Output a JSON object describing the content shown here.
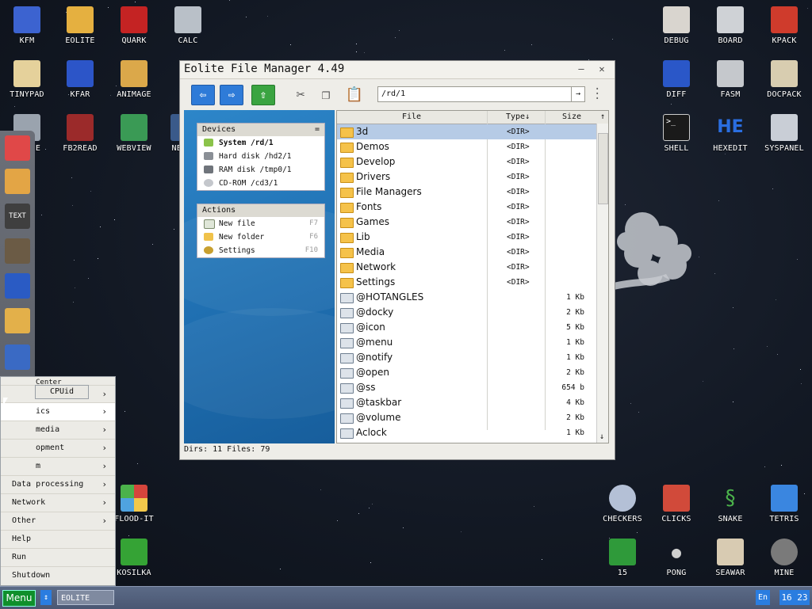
{
  "desktop_icons": [
    {
      "label": "KFM",
      "icon": "floppy-icon",
      "color": "#3c63d0"
    },
    {
      "label": "EOLITE",
      "icon": "folder-icon",
      "color": "#e5b040"
    },
    {
      "label": "QUARK",
      "icon": "book-icon",
      "color": "#c42323"
    },
    {
      "label": "CALC",
      "icon": "calculator-icon",
      "color": "#b9c0c8"
    },
    {
      "label": "TINYPAD",
      "icon": "notepad-icon",
      "color": "#e5d19b"
    },
    {
      "label": "KFAR",
      "icon": "archive-icon",
      "color": "#2c55c8"
    },
    {
      "label": "ANIMAGE",
      "icon": "paint-tools-icon",
      "color": "#dba84a"
    },
    {
      "label": "E",
      "icon": "document-icon",
      "color": "#9aa3ae"
    },
    {
      "label": "FB2READ",
      "icon": "ebook-icon",
      "color": "#9b2a2a"
    },
    {
      "label": "WEBVIEW",
      "icon": "globe-icon",
      "color": "#3a9a55"
    },
    {
      "label": "NE",
      "icon": "network-icon",
      "color": "#3a5a8a"
    },
    {
      "label": "DEBUG",
      "icon": "bug-icon",
      "color": "#d9d5cf"
    },
    {
      "label": "BOARD",
      "icon": "board-icon",
      "color": "#cfd2d6"
    },
    {
      "label": "KPACK",
      "icon": "wrench-icon",
      "color": "#cf3b2c"
    },
    {
      "label": "DIFF",
      "icon": "diff-icon",
      "color": "#2a57c8"
    },
    {
      "label": "FASM",
      "icon": "assembler-icon",
      "color": "#c5c8cc"
    },
    {
      "label": "DOCPACK",
      "icon": "cabinet-icon",
      "color": "#d8cdb0"
    },
    {
      "label": "SHELL",
      "icon": "terminal-icon",
      "color": "#1a1a1a"
    },
    {
      "label": "HEXEDIT",
      "icon": "hex-icon",
      "color": "#2a6ee0"
    },
    {
      "label": "SYSPANEL",
      "icon": "sliders-icon",
      "color": "#c9ced6"
    },
    {
      "label": "FLOOD-IT",
      "icon": "grid-colors-icon",
      "color": "#d5453c"
    },
    {
      "label": "KOSILKA",
      "icon": "lawnmower-icon",
      "color": "#35a335"
    },
    {
      "label": "CHECKERS",
      "icon": "checkers-icon",
      "color": "#b4c0d6"
    },
    {
      "label": "CLICKS",
      "icon": "blocks-icon",
      "color": "#d14a3a"
    },
    {
      "label": "SNAKE",
      "icon": "snake-icon",
      "color": "#4bb24b"
    },
    {
      "label": "TETRIS",
      "icon": "tetris-icon",
      "color": "#3a86e0"
    },
    {
      "label": "15",
      "icon": "fifteen-puzzle-icon",
      "color": "#2f9a3a"
    },
    {
      "label": "PONG",
      "icon": "pong-icon",
      "color": "#cfcfcf"
    },
    {
      "label": "SEAWAR",
      "icon": "seawar-icon",
      "color": "#d8cbb2"
    },
    {
      "label": "MINE",
      "icon": "mine-icon",
      "color": "#7a7a7a"
    }
  ],
  "start_menu": {
    "tooltip": "CPUid",
    "partial_header": "Center",
    "items": [
      {
        "label": "",
        "arrow": "›"
      },
      {
        "label": "ics",
        "arrow": "›"
      },
      {
        "label": "media",
        "arrow": "›"
      },
      {
        "label": "opment",
        "arrow": "›"
      },
      {
        "label": "m",
        "arrow": "›"
      },
      {
        "label": "Data processing",
        "arrow": "›"
      },
      {
        "label": "Network",
        "arrow": "›"
      },
      {
        "label": "Other",
        "arrow": "›"
      },
      {
        "label": "Help",
        "arrow": ""
      },
      {
        "label": "Run",
        "arrow": ""
      },
      {
        "label": "Shutdown",
        "arrow": ""
      }
    ]
  },
  "taskbar": {
    "menu": "Menu",
    "task": "EOLITE",
    "lang": "En",
    "clock": "16 23"
  },
  "window": {
    "title": "Eolite File Manager 4.49",
    "minimize": "–",
    "close": "✕",
    "path": "/rd/1",
    "go": "→",
    "devices": {
      "header": "Devices",
      "menu": "=",
      "items": [
        {
          "label": "System /rd/1",
          "bold": true,
          "color": "#8bc34a"
        },
        {
          "label": "Hard disk /hd2/1",
          "bold": false,
          "color": "#8a8f96"
        },
        {
          "label": "RAM disk /tmp0/1",
          "bold": false,
          "color": "#6f747b"
        },
        {
          "label": "CD-ROM /cd3/1",
          "bold": false,
          "color": "#c4c7cc"
        }
      ]
    },
    "actions": {
      "header": "Actions",
      "items": [
        {
          "label": "New file",
          "key": "F7",
          "color": "#dfe6d8"
        },
        {
          "label": "New folder",
          "key": "F6",
          "color": "#f0c24a"
        },
        {
          "label": "Settings",
          "key": "F10",
          "color": "#c8a030"
        }
      ]
    },
    "columns": {
      "file": "File",
      "type": "Type↓",
      "size": "Size",
      "up": "↑"
    },
    "files": [
      {
        "name": "3d",
        "type": "<DIR>",
        "size": "",
        "kind": "dir",
        "selected": true
      },
      {
        "name": "Demos",
        "type": "<DIR>",
        "size": "",
        "kind": "dir"
      },
      {
        "name": "Develop",
        "type": "<DIR>",
        "size": "",
        "kind": "dir"
      },
      {
        "name": "Drivers",
        "type": "<DIR>",
        "size": "",
        "kind": "dir"
      },
      {
        "name": "File Managers",
        "type": "<DIR>",
        "size": "",
        "kind": "dir"
      },
      {
        "name": "Fonts",
        "type": "<DIR>",
        "size": "",
        "kind": "dir"
      },
      {
        "name": "Games",
        "type": "<DIR>",
        "size": "",
        "kind": "dir"
      },
      {
        "name": "Lib",
        "type": "<DIR>",
        "size": "",
        "kind": "dir"
      },
      {
        "name": "Media",
        "type": "<DIR>",
        "size": "",
        "kind": "dir"
      },
      {
        "name": "Network",
        "type": "<DIR>",
        "size": "",
        "kind": "dir"
      },
      {
        "name": "Settings",
        "type": "<DIR>",
        "size": "",
        "kind": "dir"
      },
      {
        "name": "@HOTANGLES",
        "type": "",
        "size": "1 Kb",
        "kind": "file"
      },
      {
        "name": "@docky",
        "type": "",
        "size": "2 Kb",
        "kind": "file"
      },
      {
        "name": "@icon",
        "type": "",
        "size": "5 Kb",
        "kind": "file"
      },
      {
        "name": "@menu",
        "type": "",
        "size": "1 Kb",
        "kind": "file"
      },
      {
        "name": "@notify",
        "type": "",
        "size": "1 Kb",
        "kind": "file"
      },
      {
        "name": "@open",
        "type": "",
        "size": "2 Kb",
        "kind": "file"
      },
      {
        "name": "@ss",
        "type": "",
        "size": "654 b",
        "kind": "file"
      },
      {
        "name": "@taskbar",
        "type": "",
        "size": "4 Kb",
        "kind": "file"
      },
      {
        "name": "@volume",
        "type": "",
        "size": "2 Kb",
        "kind": "file"
      },
      {
        "name": "Aclock",
        "type": "",
        "size": "1 Kb",
        "kind": "file"
      }
    ],
    "scroll_down": "↓",
    "status": "Dirs: 11   Files: 79"
  },
  "dock_icons": [
    {
      "icon": "irc-icon",
      "color": "#e04848"
    },
    {
      "icon": "package-icon",
      "color": "#e3a545"
    },
    {
      "icon": "text-icon",
      "color": "#3f3f3f"
    },
    {
      "icon": "speaker-icon",
      "color": "#6b5b45"
    },
    {
      "icon": "midi-player-icon",
      "color": "#2a5bc4"
    },
    {
      "icon": "image-viewer-icon",
      "color": "#e3b04a"
    },
    {
      "icon": "hardware-icon",
      "color": "#3a6ac4"
    },
    {
      "icon": "cpu-icon",
      "color": "#2c3a2c"
    },
    {
      "icon": "volume-icon",
      "color": "#d8a040"
    },
    {
      "icon": "settings-sliders-icon",
      "color": "#c4cbd4"
    }
  ]
}
